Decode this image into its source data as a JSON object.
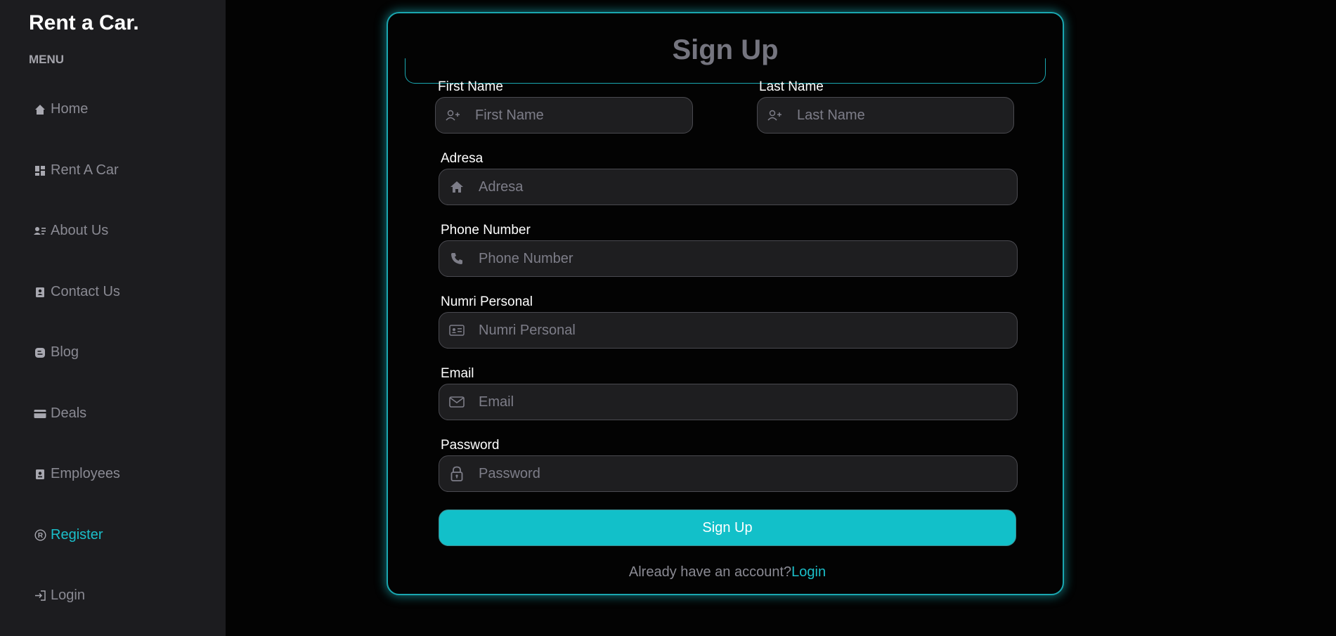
{
  "sidebar": {
    "brand": "Rent a Car.",
    "menu_label": "MENU",
    "items": [
      {
        "label": "Home",
        "icon": "home-icon"
      },
      {
        "label": "Rent A Car",
        "icon": "dashboard-icon"
      },
      {
        "label": "About Us",
        "icon": "user-list-icon"
      },
      {
        "label": "Contact Us",
        "icon": "contact-book-icon"
      },
      {
        "label": "Blog",
        "icon": "blog-icon"
      },
      {
        "label": "Deals",
        "icon": "credit-card-icon"
      },
      {
        "label": "Employees",
        "icon": "id-badge-icon"
      },
      {
        "label": "Register",
        "icon": "registered-icon",
        "active": true
      },
      {
        "label": "Login",
        "icon": "login-icon"
      }
    ]
  },
  "form": {
    "title": "Sign Up",
    "first_name": {
      "label": "First Name",
      "placeholder": "First Name",
      "value": ""
    },
    "last_name": {
      "label": "Last Name",
      "placeholder": "Last Name",
      "value": ""
    },
    "address": {
      "label": "Adresa",
      "placeholder": "Adresa",
      "value": ""
    },
    "phone": {
      "label": "Phone Number",
      "placeholder": "Phone Number",
      "value": ""
    },
    "personal_number": {
      "label": "Numri Personal",
      "placeholder": "Numri Personal",
      "value": ""
    },
    "email": {
      "label": "Email",
      "placeholder": "Email",
      "value": ""
    },
    "password": {
      "label": "Password",
      "placeholder": "Password",
      "value": ""
    },
    "submit_label": "Sign Up",
    "footer_text": "Already have an account?",
    "login_link": "Login"
  },
  "colors": {
    "accent": "#12c0c9",
    "sidebar_bg": "#1c1c1f",
    "page_bg": "#030303",
    "input_bg": "#1e1e20"
  }
}
